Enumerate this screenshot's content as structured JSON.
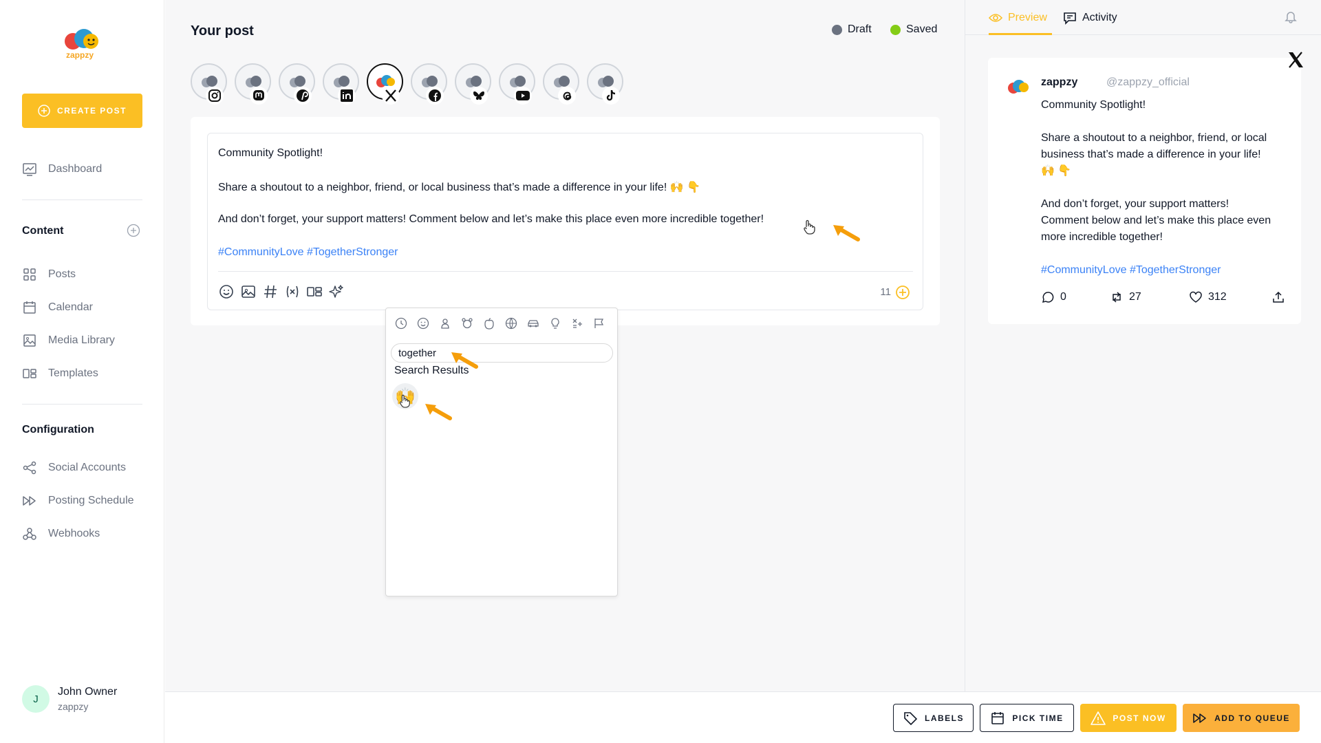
{
  "sidebar": {
    "logo_text": "zappzy",
    "create_label": "CREATE POST",
    "dashboard": "Dashboard",
    "content_title": "Content",
    "posts": "Posts",
    "calendar": "Calendar",
    "media_library": "Media Library",
    "templates": "Templates",
    "configuration_title": "Configuration",
    "social_accounts": "Social Accounts",
    "posting_schedule": "Posting Schedule",
    "webhooks": "Webhooks",
    "user": {
      "initial": "J",
      "name": "John Owner",
      "org": "zappzy"
    }
  },
  "main": {
    "title": "Your post",
    "status": [
      {
        "label": "Draft",
        "color": "#6b7280"
      },
      {
        "label": "Saved",
        "color": "#84cc16"
      }
    ],
    "accounts": [
      "instagram",
      "mastodon",
      "pinterest",
      "linkedin",
      "x",
      "facebook",
      "bluesky",
      "youtube",
      "threads",
      "tiktok"
    ],
    "active_account": "x",
    "editor": {
      "line1": "Community Spotlight!",
      "line2": "Share a shoutout to a neighbor, friend, or local business that’s made a difference in your life! 🙌 👇",
      "line3": "And don’t forget, your support matters! Comment below and let’s make this place even more incredible together!",
      "tags": "#CommunityLove #TogetherStronger",
      "char_count": "11"
    },
    "emoji_picker": {
      "search_value": "together",
      "results_label": "Search Results",
      "result_emoji": "🙌"
    }
  },
  "preview": {
    "tab_preview": "Preview",
    "tab_activity": "Activity",
    "tweet": {
      "name": "zappzy",
      "handle": "@zappzy_official",
      "p1": "Community Spotlight!",
      "p2": "Share a shoutout to a neighbor, friend, or local business that’s made a difference in your life! 🙌 👇",
      "p3": "And don’t forget, your support matters! Comment below and let’s make this place even more incredible together!",
      "tags": "#CommunityLove #TogetherStronger",
      "replies": "0",
      "retweets": "27",
      "likes": "312"
    }
  },
  "bottom": {
    "labels": "LABELS",
    "pick_time": "PICK TIME",
    "post_now": "POST NOW",
    "add_to_queue": "ADD TO QUEUE"
  },
  "colors": {
    "accent": "#fbbf24",
    "accent_dark": "#f59e0b",
    "link": "#3b82f6"
  }
}
